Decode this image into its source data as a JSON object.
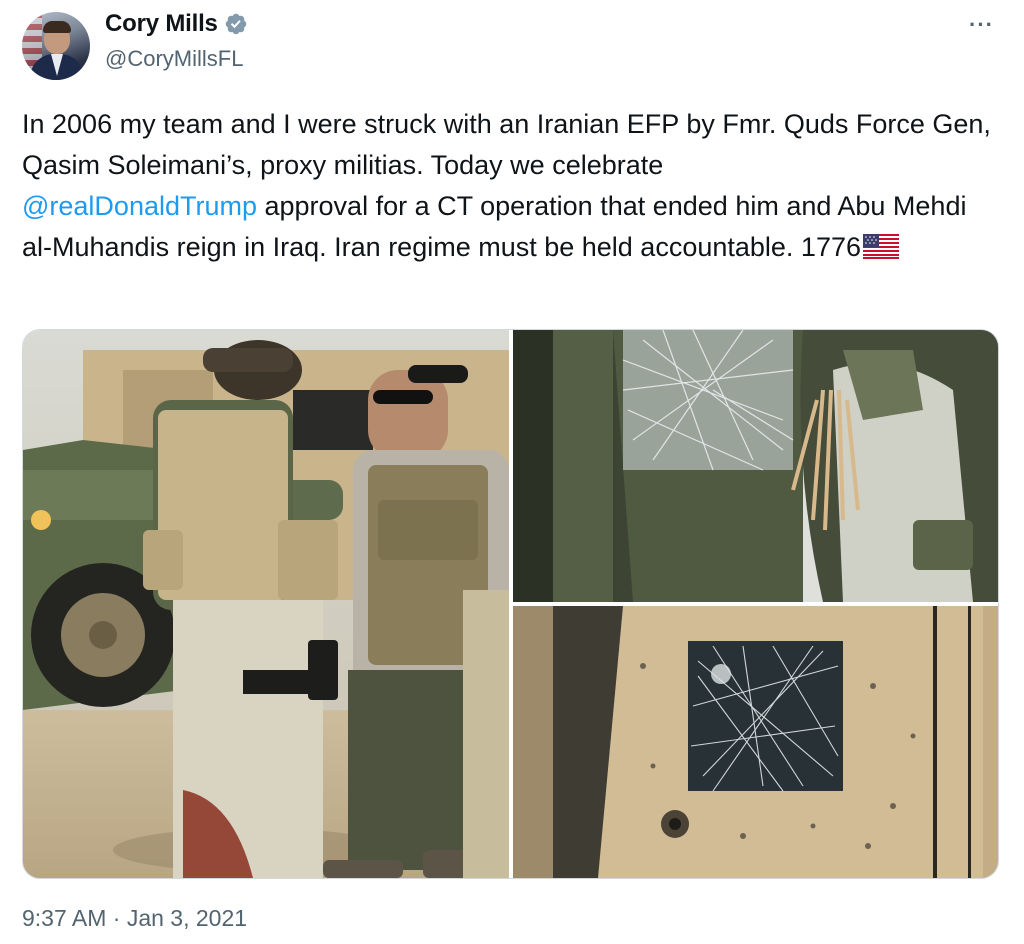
{
  "author": {
    "display_name": "Cory Mills",
    "handle": "@CoryMillsFL",
    "verified": true,
    "verified_color": "#829aab"
  },
  "tweet": {
    "text_before_mention": "In 2006 my team and I were struck with an Iranian EFP by Fmr. Quds Force Gen, Qasim Soleimani’s, proxy militias. Today we celebrate",
    "mention": "@realDonaldTrump",
    "text_after_mention": " approval for a CT operation that ended him and Abu Mehdi al-Muhandis reign in Iraq. Iran regime must be held accountable. 1776",
    "emoji": "us-flag-emoji",
    "mention_color": "#1d9bf0"
  },
  "media": {
    "count": 3,
    "photos": [
      {
        "name": "soldiers-with-humvee-photo"
      },
      {
        "name": "shattered-door-window-photo"
      },
      {
        "name": "cracked-armored-window-photo"
      }
    ]
  },
  "meta": {
    "timestamp": "9:37 AM · Jan 3, 2021"
  },
  "icons": {
    "more": "more-options-icon",
    "verified": "verified-badge-icon"
  }
}
